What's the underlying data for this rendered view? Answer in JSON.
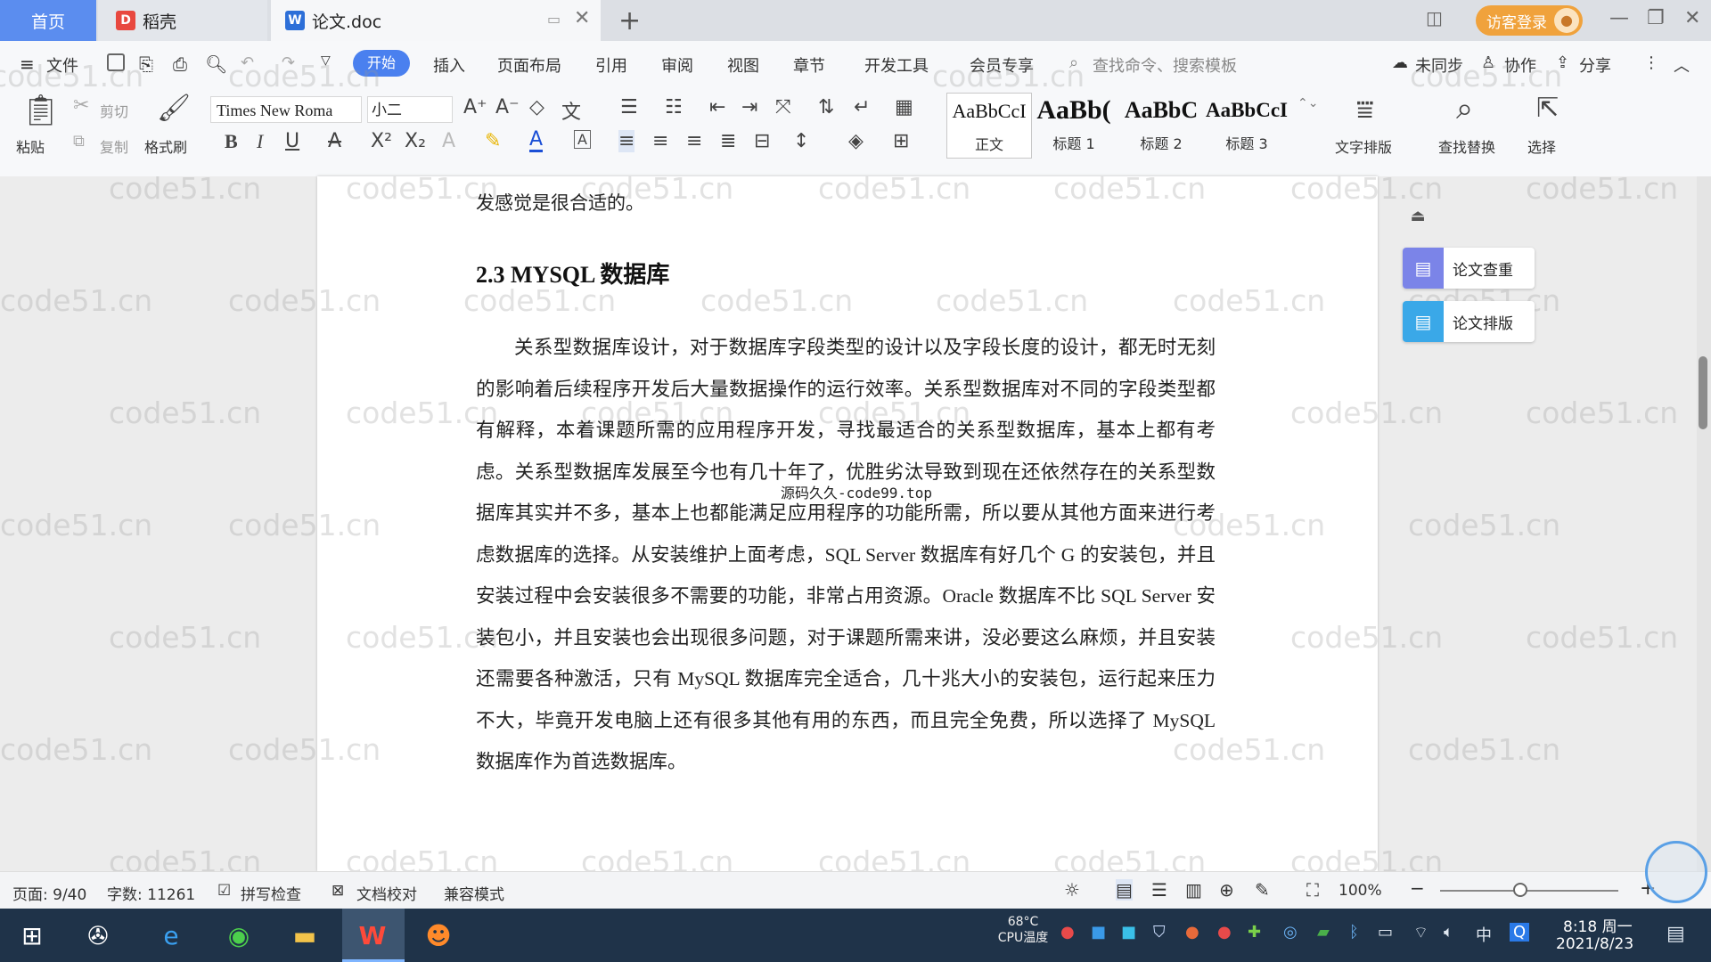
{
  "titlebar": {
    "tab_home": "首页",
    "tab_daoke": "稻壳",
    "tab_doc": "论文.doc",
    "login": "访客登录"
  },
  "menubar": {
    "file": "文件",
    "items": [
      "开始",
      "插入",
      "页面布局",
      "引用",
      "审阅",
      "视图",
      "章节",
      "开发工具",
      "会员专享"
    ],
    "search_placeholder": "查找命令、搜索模板",
    "unsynced": "未同步",
    "collab": "协作",
    "share": "分享"
  },
  "ribbon": {
    "paste": "粘贴",
    "cut": "剪切",
    "copy": "复制",
    "format_painter": "格式刷",
    "font_name": "Times New Roma",
    "font_size": "小二",
    "styles": [
      {
        "preview": "AaBbCcI",
        "label": "正文"
      },
      {
        "preview": "AaBb(",
        "label": "标题 1"
      },
      {
        "preview": "AaBbC",
        "label": "标题 2"
      },
      {
        "preview": "AaBbCcI",
        "label": "标题 3"
      }
    ],
    "text_layout": "文字排版",
    "find_replace": "查找替换",
    "select": "选择"
  },
  "document": {
    "prev_line": "发感觉是很合适的。",
    "heading": "2.3 MYSQL 数据库",
    "paragraph": "关系型数据库设计，对于数据库字段类型的设计以及字段长度的设计，都无时无刻的影响着后续程序开发后大量数据操作的运行效率。关系型数据库对不同的字段类型都有解释，本着课题所需的应用程序开发，寻找最适合的关系型数据库，基本上都有考虑。关系型数据库发展至今也有几十年了，优胜劣汰导致到现在还依然存在的关系型数据库其实并不多，基本上也都能满足应用程序的功能所需，所以要从其他方面来进行考虑数据库的选择。从安装维护上面考虑，SQL Server 数据库有好几个 G 的安装包，并且安装过程中会安装很多不需要的功能，非常占用资源。Oracle 数据库不比 SQL Server 安装包小，并且安装也会出现很多问题，对于课题所需来讲，没必要这么麻烦，并且安装还需要各种激活，只有 MySQL 数据库完全适合，几十兆大小的安装包，运行起来压力不大，毕竟开发电脑上还有很多其他有用的东西，而且完全免费，所以选择了 MySQL 数据库作为首选数据库。",
    "overlay": "源码久久-code99.top",
    "watermark": "code51.cn"
  },
  "side_panel": {
    "check": "论文查重",
    "layout": "论文排版"
  },
  "status": {
    "page": "页面: 9/40",
    "words": "字数: 11261",
    "spell": "拼写检查",
    "proof": "文档校对",
    "compat": "兼容模式",
    "zoom": "100%",
    "zoom_level": 0.45
  },
  "taskbar": {
    "cpu_temp": "68°C",
    "cpu_label": "CPU温度",
    "ime": "中",
    "time": "8:18 周一",
    "date": "2021/8/23"
  }
}
